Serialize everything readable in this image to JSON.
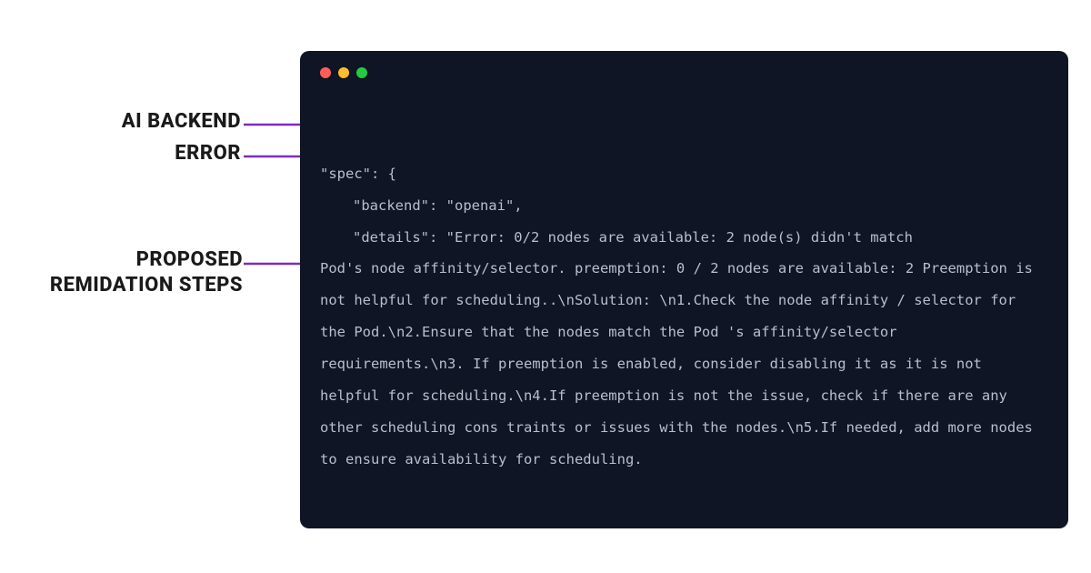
{
  "labels": {
    "backend": "AI BACKEND",
    "error": "ERROR",
    "remediation_line1": "PROPOSED",
    "remediation_line2": "REMIDATION STEPS"
  },
  "colors": {
    "terminal_bg": "#0f1524",
    "terminal_text": "#b8bfcc",
    "arrow": "#7b2cbf",
    "traffic_red": "#ff5f56",
    "traffic_yellow": "#ffbd2e",
    "traffic_green": "#27c93f"
  },
  "code": {
    "line1": "\"spec\": {",
    "line2": "\"backend\": \"openai\",",
    "line3_start": "\"details\": \"Error: 0/2 nodes are available: 2 node(s) didn't match ",
    "rest": "Pod's node affinity/selector. preemption: 0 / 2 nodes are available: 2 Preemption is not helpful for scheduling..\\nSolution: \\n1.Check the node affinity / selector for the Pod.\\n2.Ensure that the nodes match the Pod 's affinity/selector requirements.\\n3. If preemption is enabled, consider disabling it as it is not helpful for scheduling.\\n4.If preemption is not the issue, check if there are any other scheduling cons traints or issues with the nodes.\\n5.If needed, add more nodes to ensure availability for scheduling."
  }
}
